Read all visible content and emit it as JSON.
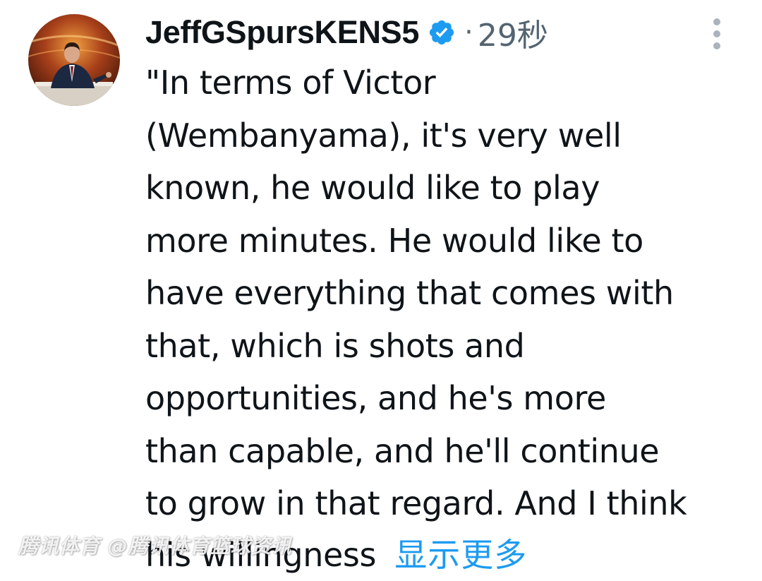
{
  "tweet": {
    "display_name": "JeffGSpursKENS5",
    "separator": "·",
    "timestamp": "29秒",
    "body_lines": [
      "\"In terms of Victor",
      "(Wembanyama), it's very well",
      "known, he would like to play",
      "more minutes. He would like to",
      "have everything that comes with",
      "that, which is shots and",
      "opportunities, and he's more",
      "than capable, and he'll continue",
      "to grow in that regard. And I think"
    ],
    "last_line": "his willingness",
    "show_more": "显示更多"
  },
  "watermark": "腾讯体育 @腾讯体育篮球资讯",
  "colors": {
    "text": "#0f1419",
    "muted": "#536471",
    "link": "#1d9bf0",
    "verified": "#1d9bf0"
  },
  "icons": {
    "verified": "verified-badge-icon",
    "more": "more-vertical-icon"
  }
}
